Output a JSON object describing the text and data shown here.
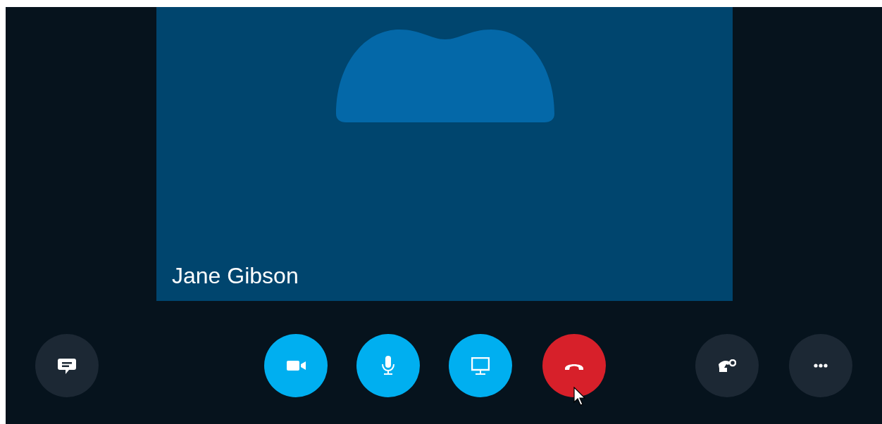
{
  "participant": {
    "name": "Jane Gibson",
    "kind": "avatar"
  },
  "controls": [
    {
      "kind": "chat"
    },
    {
      "kind": "video"
    },
    {
      "kind": "mic"
    },
    {
      "kind": "screen"
    },
    {
      "kind": "hangup"
    },
    {
      "kind": "call-settings"
    },
    {
      "kind": "more"
    }
  ]
}
